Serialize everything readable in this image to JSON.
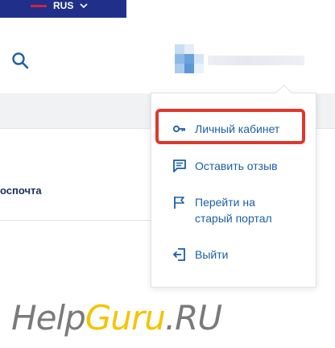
{
  "header": {
    "language": "RUS"
  },
  "user_menu": {
    "items": [
      {
        "label": "Личный кабинет",
        "icon": "key-icon"
      },
      {
        "label": "Оставить отзыв",
        "icon": "feedback-icon"
      },
      {
        "label": "Перейти на старый портал",
        "icon": "flag-portal-icon"
      },
      {
        "label": "Выйти",
        "icon": "logout-icon"
      }
    ]
  },
  "content": {
    "email_fragment": "оспочта"
  },
  "watermark": {
    "help": "Help",
    "guru": "Guru",
    "ru": ".RU"
  },
  "colors": {
    "accent": "#1a5fa8",
    "topbar": "#1f2f8a",
    "highlight": "#e0372c",
    "watermark_yellow": "#f5c400"
  }
}
